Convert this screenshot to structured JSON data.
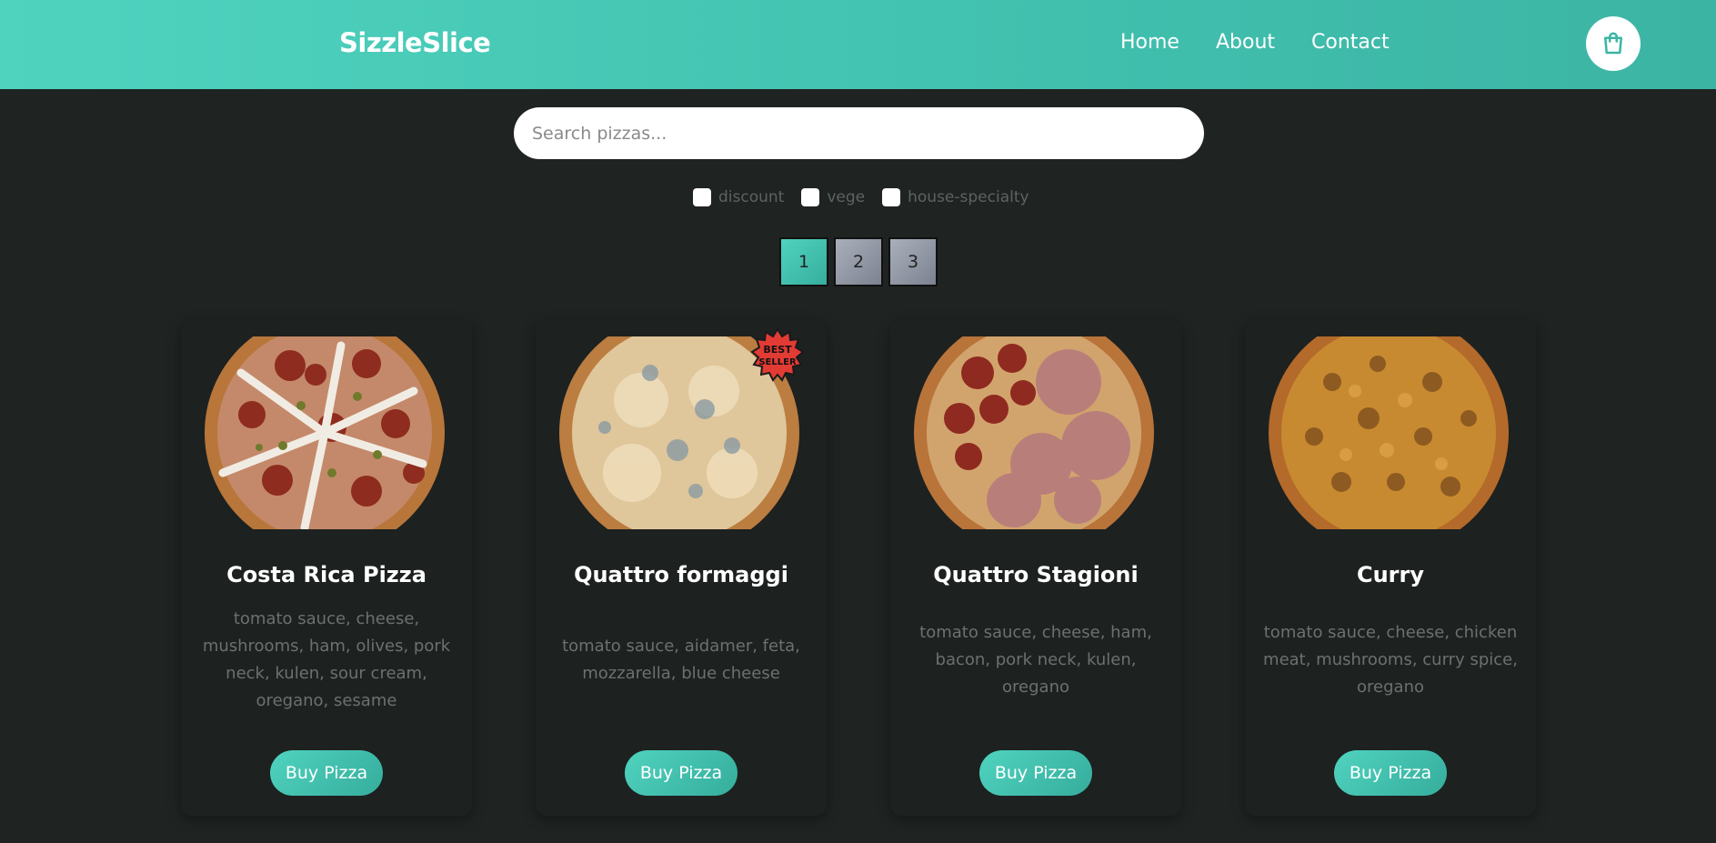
{
  "header": {
    "brand": "SizzleSlice",
    "nav": [
      "Home",
      "About",
      "Contact"
    ],
    "cart_icon": "shopping-bag-icon"
  },
  "search": {
    "placeholder": "Search pizzas..."
  },
  "filters": [
    "discount",
    "vege",
    "house-specialty"
  ],
  "pagination": {
    "pages": [
      "1",
      "2",
      "3"
    ],
    "active": "1"
  },
  "pizzas": [
    {
      "name": "Costa Rica Pizza",
      "description": "tomato sauce, cheese, mushrooms, ham, olives, pork neck, kulen, sour cream, oregano, sesame",
      "button": "Buy Pizza"
    },
    {
      "name": "Quattro formaggi",
      "description": "tomato sauce, aidamer, feta, mozzarella, blue cheese",
      "button": "Buy Pizza",
      "badge": "BEST SELLER"
    },
    {
      "name": "Quattro Stagioni",
      "description": "tomato sauce, cheese, ham, bacon, pork neck, kulen, oregano",
      "button": "Buy Pizza"
    },
    {
      "name": "Curry",
      "description": "tomato sauce, cheese, chicken meat, mushrooms, curry spice, oregano",
      "button": "Buy Pizza"
    }
  ],
  "colors": {
    "accent": "#45c9b6",
    "background": "#1f2322",
    "card": "#1d2120",
    "muted_text": "#6c7170"
  }
}
